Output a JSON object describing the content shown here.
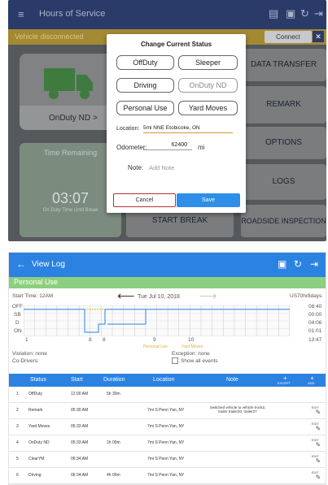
{
  "top": {
    "appbar": {
      "title": "Hours of Service",
      "menu_icon": "menu-icon"
    },
    "banner": {
      "text": "Vehicle disconnected",
      "connect_label": "Connect",
      "close_label": "✕"
    },
    "status_tile": {
      "label": "OnDuty ND",
      "chevron": ">"
    },
    "remaining_tile": {
      "label": "Time Remaining",
      "time": "03:07",
      "sub": "On Duty Time Until Break"
    },
    "right_buttons": [
      "DATA TRANSFER",
      "REMARK",
      "OPTIONS",
      "LOGS",
      "ROADSIDE INSPECTION"
    ],
    "start_break": "START BREAK",
    "modal": {
      "title": "Change Current Status",
      "buttons": [
        {
          "label": "OffDuty",
          "enabled": true
        },
        {
          "label": "Sleeper",
          "enabled": true
        },
        {
          "label": "Driving",
          "enabled": true
        },
        {
          "label": "OnDuty ND",
          "enabled": false
        },
        {
          "label": "Personal Use",
          "enabled": true
        },
        {
          "label": "Yard Moves",
          "enabled": true
        }
      ],
      "location_label": "Location:",
      "location_value": "5mi NNE Etobicoke, ON",
      "odometer_label": "Odometer:",
      "odometer_value": "62400",
      "odometer_unit": "mi",
      "note_label": "Note:",
      "note_placeholder": "Add Note",
      "cancel_label": "Cancel",
      "save_label": "Save"
    }
  },
  "bottom": {
    "appbar": {
      "title": "View Log"
    },
    "status_banner": "Personal Use",
    "start_time": "Start Time: 12AM",
    "date": "Tue Jul 10, 2018",
    "cycle": "US70hr8days",
    "grid_rows": [
      "OFF",
      "SB",
      "D",
      "ON"
    ],
    "grid_totals": [
      "08:40",
      "00:00",
      "04:06",
      "01:01"
    ],
    "grid_total_sum": "13:47",
    "grid_axis": [
      "1",
      "8",
      "8",
      "9",
      "10"
    ],
    "legend": [
      "Personal Use",
      "Yard Moves"
    ],
    "violation": "Violation: none",
    "exception": "Exception: none",
    "co_drivers": "Co-Drivers:",
    "show_all_events": "Show all events",
    "colors": {
      "accent": "#2b82e0",
      "personal_use": "#8ccf7e"
    },
    "table_headers": [
      "Status",
      "Start",
      "Duration",
      "Location",
      "Note",
      "EXCEPT",
      "ADD"
    ],
    "rows": [
      {
        "n": "1",
        "status": "OffDuty",
        "start": "12:00 AM",
        "duration": "5h 30m",
        "location": "",
        "note": "",
        "edit": false
      },
      {
        "n": "2",
        "status": "Remark",
        "start": "05:30 AM",
        "duration": "",
        "location": "7mi S Penn Yan, NY",
        "note": "Switched vehicle to vehicle truck2, trailer trailer20, trailer27",
        "edit": true
      },
      {
        "n": "3",
        "status": "Yard Moves",
        "start": "05:33 AM",
        "duration": "",
        "location": "7mi S Penn Yan, NY",
        "note": "",
        "edit": true
      },
      {
        "n": "4",
        "status": "OnDuty ND",
        "start": "05:33 AM",
        "duration": "1h 00m",
        "location": "7mi S Penn Yan, NY",
        "note": "",
        "edit": true
      },
      {
        "n": "5",
        "status": "ClearYM",
        "start": "06:34 AM",
        "duration": "",
        "location": "7mi S Penn Yan, NY",
        "note": "",
        "edit": true
      },
      {
        "n": "6",
        "status": "Driving",
        "start": "06:34 AM",
        "duration": "4h 00m",
        "location": "7mi S Penn Yan, NY",
        "note": "",
        "edit": true
      }
    ],
    "edit_label": "EDIT"
  }
}
